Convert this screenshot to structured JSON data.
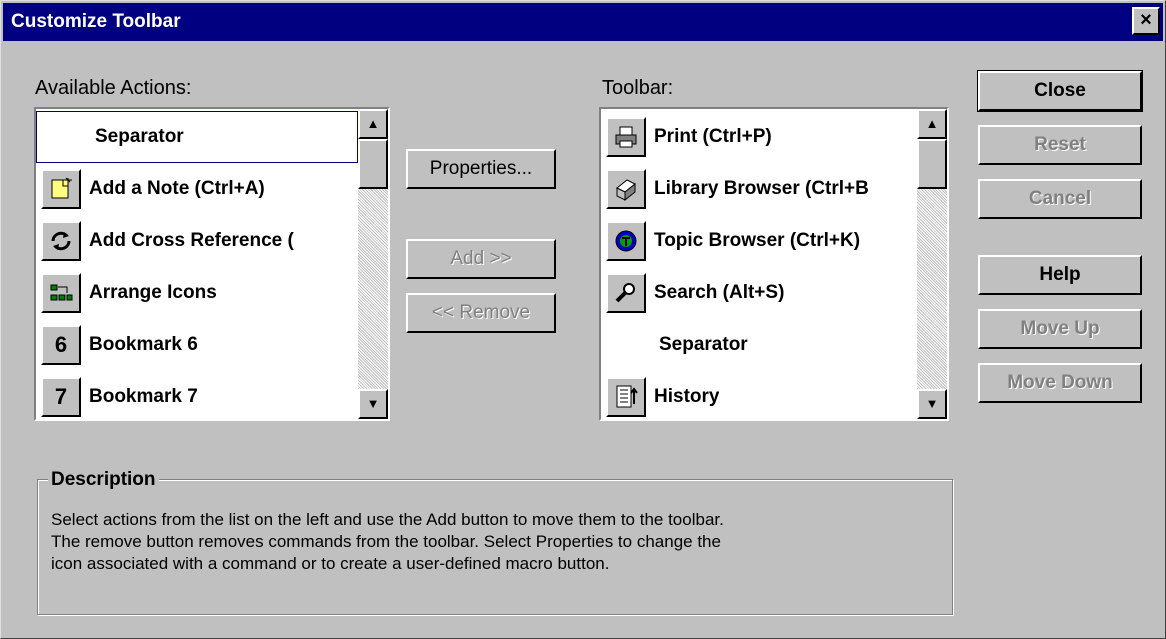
{
  "window": {
    "title": "Customize Toolbar",
    "close_glyph": "×"
  },
  "available": {
    "label": "Available Actions:",
    "items": [
      {
        "label": "Separator",
        "icon": ""
      },
      {
        "label": "Add a Note (Ctrl+A)",
        "icon": "note-icon"
      },
      {
        "label": "Add Cross Reference (",
        "icon": "cross-reference-icon"
      },
      {
        "label": "Arrange Icons",
        "icon": "arrange-icons-icon"
      },
      {
        "label": "Bookmark 6",
        "icon": "6"
      },
      {
        "label": "Bookmark 7",
        "icon": "7"
      }
    ]
  },
  "toolbar": {
    "label": "Toolbar:",
    "items": [
      {
        "label": "Print (Ctrl+P)",
        "icon": "printer-icon"
      },
      {
        "label": "Library Browser (Ctrl+B",
        "icon": "library-icon"
      },
      {
        "label": "Topic Browser (Ctrl+K)",
        "icon": "topic-icon"
      },
      {
        "label": "Search (Alt+S)",
        "icon": "magnifier-icon"
      },
      {
        "label": "Separator",
        "icon": ""
      },
      {
        "label": "History",
        "icon": "history-icon"
      }
    ]
  },
  "middle_buttons": {
    "properties": "Properties...",
    "add": "Add >>",
    "remove": "<< Remove"
  },
  "right_buttons": {
    "close": "Close",
    "reset": "Reset",
    "cancel": "Cancel",
    "help": "Help",
    "move_up": "Move Up",
    "move_down": "Move Down"
  },
  "description": {
    "title": "Description",
    "line1": "Select actions from the list on the left and use the Add button to move them to the toolbar.",
    "line2": "The remove button removes commands from the toolbar. Select Properties to change the",
    "line3": "icon associated with a command or to create a user-defined macro button."
  }
}
